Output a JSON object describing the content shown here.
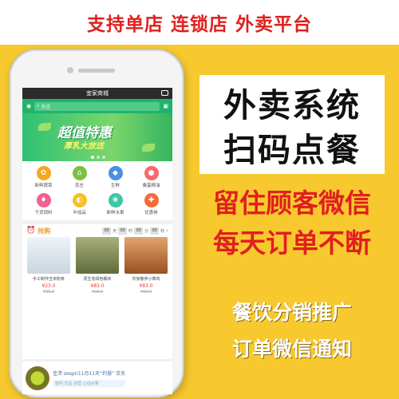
{
  "banner": {
    "text": "支持单店 连锁店 外卖平台"
  },
  "phone": {
    "app_title": "宜家商城",
    "search_placeholder": "农庄",
    "hero": {
      "line1": "超值特惠",
      "line2": "厚乳大放送"
    },
    "categories": [
      {
        "label": "新鲜蔬菜",
        "color": "#f5a623",
        "icon": "✿"
      },
      {
        "label": "农庄",
        "color": "#7bc043",
        "icon": "⌂"
      },
      {
        "label": "生鲜",
        "color": "#4a90e2",
        "icon": "◆"
      },
      {
        "label": "禽蛋粮油",
        "color": "#f56b6b",
        "icon": "●"
      },
      {
        "label": "干货调料",
        "color": "#f06292",
        "icon": "♦"
      },
      {
        "label": "半成品",
        "color": "#f5c02a",
        "icon": "◐"
      },
      {
        "label": "新鲜水果",
        "color": "#3ec4a6",
        "icon": "❀"
      },
      {
        "label": "优惠券",
        "color": "#f26b3a",
        "icon": "✚"
      }
    ],
    "rush": {
      "title": "抢购",
      "timer": [
        {
          "value": "00",
          "unit": "天"
        },
        {
          "value": "00",
          "unit": "时"
        },
        {
          "value": "00",
          "unit": "分"
        },
        {
          "value": "00",
          "unit": "秒"
        }
      ]
    },
    "products": [
      {
        "name": "手工制作玉米粉条",
        "price": "¥23.0",
        "old": "¥30.0",
        "color": "#d8e6ee"
      },
      {
        "name": "原生态绿色糯米",
        "price": "¥83.0",
        "old": "¥90.0",
        "color": "#7d8b5a"
      },
      {
        "name": "农家散养小菜鸡",
        "price": "¥83.0",
        "old": "¥90.0",
        "color": "#c0753a"
      }
    ],
    "ad": {
      "line1": "佳沛 zespri11月11天“约慧” 京东",
      "line2": "智利 优品 自营 心动水果"
    }
  },
  "right": {
    "line1": "外卖系统",
    "line2": "扫码点餐",
    "line3": "留住顾客微信",
    "line4": "每天订单不断",
    "line5": "餐饮分销推广",
    "line6": "订单微信通知"
  }
}
